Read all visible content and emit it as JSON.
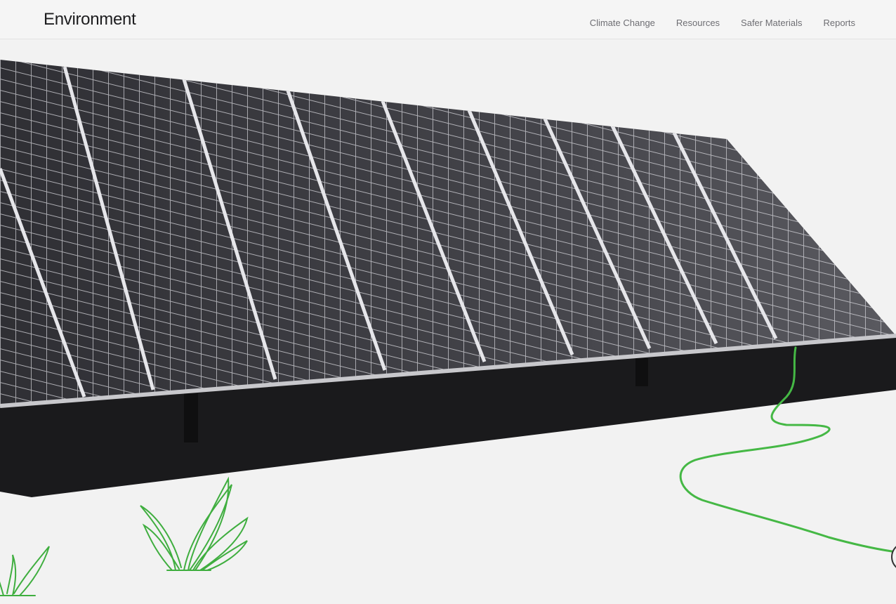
{
  "header": {
    "title": "Environment",
    "nav": [
      "Climate Change",
      "Resources",
      "Safer Materials",
      "Reports"
    ]
  },
  "hero": {
    "illustration": "solar-panel-array-with-plants",
    "colors": {
      "background": "#f2f2f2",
      "panel_frame": "#c8c8c8",
      "cells": "#3a3a3f",
      "shadow": "#1a1a1a",
      "plant": "#3fae3f"
    }
  }
}
